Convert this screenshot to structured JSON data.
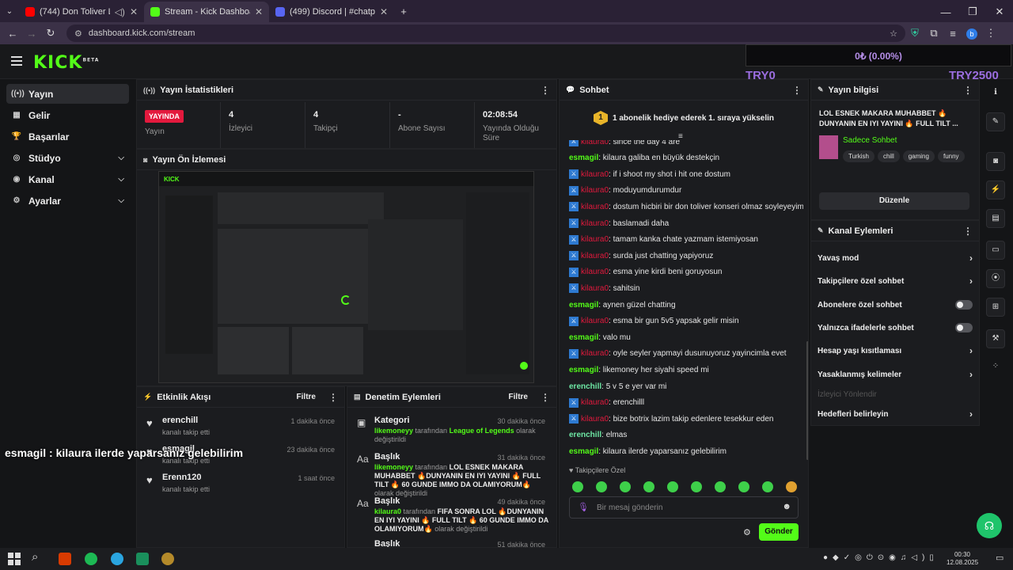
{
  "browser": {
    "tabs": [
      {
        "title": "(744) Don Toliver LIVE @ H",
        "color": "#ff0000"
      },
      {
        "title": "Stream - Kick Dashboard",
        "color": "#53fc18"
      },
      {
        "title": "(499) Discord | #chatplansk",
        "color": "#5865f2"
      }
    ],
    "new_tab": "+",
    "url": "dashboard.kick.com/stream",
    "profile_initial": "b"
  },
  "overlay": {
    "amount": "0₺ (0.00%)",
    "left_label": "TRY0",
    "right_label": "TRY2500",
    "chat_overlay": "esmagil : kilaura ilerde yaparsanız gelebilirim"
  },
  "logo": {
    "text": "KICK",
    "sup": "BETA"
  },
  "sidebar": {
    "items": [
      {
        "label": "Yayın",
        "icon": "((•))"
      },
      {
        "label": "Gelir",
        "icon": "▦"
      },
      {
        "label": "Başarılar",
        "icon": "🏆"
      },
      {
        "label": "Stüdyo",
        "icon": "◎"
      },
      {
        "label": "Kanal",
        "icon": "◉"
      },
      {
        "label": "Ayarlar",
        "icon": "⚙"
      }
    ]
  },
  "stats": {
    "title": "Yayın İstatistikleri",
    "live_badge": "YAYINDA",
    "items": [
      {
        "label": "Yayın"
      },
      {
        "value": "4",
        "label": "İzleyici"
      },
      {
        "value": "4",
        "label": "Takipçi"
      },
      {
        "value": "-",
        "label": "Abone Sayısı"
      },
      {
        "value": "02:08:54",
        "label": "Yayında Olduğu Süre"
      }
    ]
  },
  "preview": {
    "title": "Yayın Ön İzlemesi"
  },
  "activity": {
    "title": "Etkinlik Akışı",
    "filter": "Filtre",
    "items": [
      {
        "name": "erenchill",
        "sub": "kanalı takip etti",
        "time": "1 dakika önce"
      },
      {
        "name": "esmagil",
        "sub": "kanalı takip etti",
        "time": "23 dakika önce"
      },
      {
        "name": "Erenn120",
        "sub": "kanalı takip etti",
        "time": "1 saat önce"
      }
    ]
  },
  "moderation": {
    "title": "Denetim Eylemleri",
    "filter": "Filtre",
    "items": [
      {
        "title": "Kategori",
        "time": "30 dakika önce",
        "user": "likemoneyy",
        "mid": " tarafından ",
        "value": "League of Legends",
        "tail": " olarak değiştirildi"
      },
      {
        "title": "Başlık",
        "time": "31 dakika önce",
        "user": "likemoneyy",
        "mid": " tarafından ",
        "value": "LOL ESNEK MAKARA MUHABBET 🔥DUNYANIN EN IYI YAYINI 🔥 FULL TILT 🔥 60 GUNDE IMMO DA OLAMIYORUM🔥",
        "tail": " olarak değiştirildi"
      },
      {
        "title": "Başlık",
        "time": "49 dakika önce",
        "user": "kilaura0",
        "mid": " tarafından ",
        "value": "FIFA SONRA LOL 🔥DUNYANIN EN IYI YAYINI 🔥 FULL TILT 🔥 60 GUNDE IMMO DA OLAMIYORUM🔥",
        "tail": " olarak değiştirildi"
      },
      {
        "title": "Başlık",
        "time": "51 dakika önce"
      }
    ]
  },
  "chat": {
    "title": "Sohbet",
    "pinned": "1 abonelik hediye ederek 1. sıraya yükselin",
    "pinned_rank": "1",
    "messages": [
      {
        "user": "kilaura0",
        "text": ": since the day 4 are",
        "style": "red"
      },
      {
        "user": "esmagil",
        "text": ": kilaura galiba en büyük destekçin",
        "style": "green"
      },
      {
        "user": "kilaura0",
        "text": ": if i shoot my shot i hit one dostum",
        "style": "red"
      },
      {
        "user": "kilaura0",
        "text": ": moduyumdurumdur",
        "style": "red"
      },
      {
        "user": "kilaura0",
        "text": ": dostum hicbiri bir don toliver konseri olmaz soyleyeyim",
        "style": "red"
      },
      {
        "user": "kilaura0",
        "text": ": baslamadi daha",
        "style": "red"
      },
      {
        "user": "kilaura0",
        "text": ": tamam kanka chate yazmam istemiyosan",
        "style": "red"
      },
      {
        "user": "kilaura0",
        "text": ": surda just chatting yapiyoruz",
        "style": "red"
      },
      {
        "user": "kilaura0",
        "text": ": esma yine kirdi beni goruyosun",
        "style": "red"
      },
      {
        "user": "kilaura0",
        "text": ": sahitsin",
        "style": "red"
      },
      {
        "user": "esmagil",
        "text": ": aynen güzel chatting",
        "style": "green"
      },
      {
        "user": "kilaura0",
        "text": ": esma bir gun 5v5 yapsak gelir misin",
        "style": "red"
      },
      {
        "user": "esmagil",
        "text": ": valo mu",
        "style": "green"
      },
      {
        "user": "kilaura0",
        "text": ": oyle seyler yapmayi dusunuyoruz yayincimla evet",
        "style": "red"
      },
      {
        "user": "esmagil",
        "text": ": likemoney her siyahi speed mi",
        "style": "green"
      },
      {
        "user": "erenchill",
        "text": ": 5 v 5 e yer var mi",
        "style": "green2"
      },
      {
        "user": "kilaura0",
        "text": ": erenchilll",
        "style": "red"
      },
      {
        "user": "kilaura0",
        "text": ": bize botrix lazim takip edenlere tesekkur eden",
        "style": "red"
      },
      {
        "user": "erenchill",
        "text": ": elmas",
        "style": "green2"
      },
      {
        "user": "esmagil",
        "text": ": kilaura ilerde yaparsanız gelebilirim",
        "style": "green"
      }
    ],
    "followers_only": "Takipçilere Özel",
    "input_placeholder": "Bir mesaj gönderin",
    "send": "Gönder"
  },
  "stream_info": {
    "title": "Yayın bilgisi",
    "stream_title": "LOL ESNEK MAKARA MUHABBET 🔥 DUNYANIN EN IYI YAYINI 🔥 FULL TILT ...",
    "category": "Sadece Sohbet",
    "tags": [
      "Turkish",
      "chill",
      "gaming",
      "funny"
    ],
    "edit": "Düzenle"
  },
  "channel_actions": {
    "title": "Kanal Eylemleri",
    "items": [
      {
        "label": "Yavaş mod",
        "type": "arrow"
      },
      {
        "label": "Takipçilere özel sohbet",
        "type": "arrow"
      },
      {
        "label": "Abonelere özel sohbet",
        "type": "toggle"
      },
      {
        "label": "Yalnızca ifadelerle sohbet",
        "type": "toggle"
      },
      {
        "label": "Hesap yaşı kısıtlaması",
        "type": "arrow"
      },
      {
        "label": "Yasaklanmış kelimeler",
        "type": "arrow"
      },
      {
        "label": "İzleyici Yönlendir",
        "type": "disabled"
      },
      {
        "label": "Hedefleri belirleyin",
        "type": "arrow"
      }
    ]
  },
  "taskbar": {
    "time": "00:30",
    "date": "12.08.2025"
  }
}
